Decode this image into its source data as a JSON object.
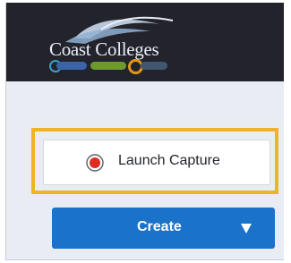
{
  "header": {
    "logo_text": "Coast Colleges",
    "logo_colors": {
      "background": "#23242b",
      "wave": "#c9d8ea",
      "badge_blue": "#3a63a8",
      "badge_green": "#6c9a2e",
      "badge_orange": "#e2961c"
    }
  },
  "capture": {
    "label": "Launch Capture",
    "icon": "record-icon",
    "icon_color": "#e02b20",
    "highlight_color": "#f0b323"
  },
  "create": {
    "label": "Create",
    "icon": "triangle-down-icon",
    "color": "#1a73c9"
  }
}
